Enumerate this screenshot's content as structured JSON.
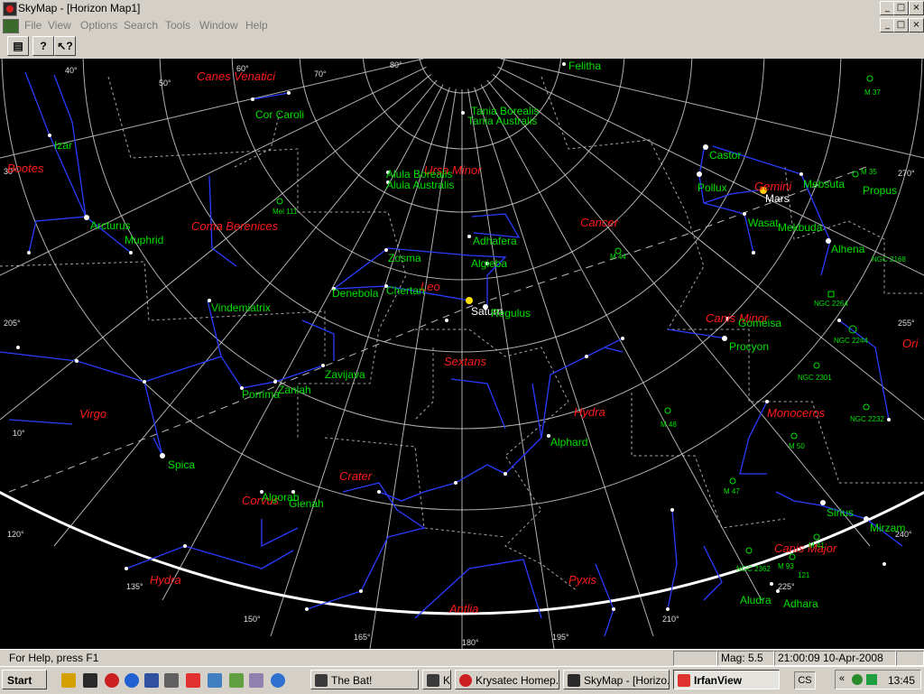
{
  "window": {
    "title": "SkyMap - [Horizon Map1]",
    "controls": [
      "_",
      "□",
      "×"
    ],
    "doc_controls": [
      "_",
      "□",
      "×"
    ]
  },
  "menu": [
    "File",
    "View",
    "Options",
    "Search",
    "Tools",
    "Window",
    "Help"
  ],
  "toolbar": {
    "buttons": [
      {
        "name": "open-folder-icon",
        "glyph": "▤"
      },
      {
        "name": "help-icon",
        "glyph": "?"
      },
      {
        "name": "context-help-icon",
        "glyph": "↖?"
      }
    ]
  },
  "sky": {
    "stars": [
      {
        "label": "Felitha"
      },
      {
        "label": "Cor Caroli"
      },
      {
        "label": "Tania Borealis"
      },
      {
        "label": "Tania Australis"
      },
      {
        "label": "Izar"
      },
      {
        "label": "Alula Borealis"
      },
      {
        "label": "Alula Australis"
      },
      {
        "label": "Castor"
      },
      {
        "label": "Pollux"
      },
      {
        "label": "Mars"
      },
      {
        "label": "Mebsuta"
      },
      {
        "label": "Propus"
      },
      {
        "label": "Arcturus"
      },
      {
        "label": "Muphrid"
      },
      {
        "label": "Wasat"
      },
      {
        "label": "Mekbuda"
      },
      {
        "label": "Adhafera"
      },
      {
        "label": "Algieba"
      },
      {
        "label": "Alhena"
      },
      {
        "label": "Zosma"
      },
      {
        "label": "Denebola"
      },
      {
        "label": "Chertan"
      },
      {
        "label": "Saturn"
      },
      {
        "label": "Regulus"
      },
      {
        "label": "Vindemiatrix"
      },
      {
        "label": "Gomeisa"
      },
      {
        "label": "Procyon"
      },
      {
        "label": "Zavijava"
      },
      {
        "label": "Zaniah"
      },
      {
        "label": "Porrima"
      },
      {
        "label": "Alphard"
      },
      {
        "label": "Spica"
      },
      {
        "label": "Algorab"
      },
      {
        "label": "Gienah"
      },
      {
        "label": "Sirius"
      },
      {
        "label": "Mirzam"
      },
      {
        "label": "Aludra"
      },
      {
        "label": "Adhara"
      }
    ],
    "constellations": [
      "Canes Venatici",
      "Ursa Minor",
      "Bootes",
      "Coma Berenices",
      "Cancer",
      "Gemini",
      "Leo",
      "Canis Minor",
      "Sextans",
      "Hydra",
      "Monoceros",
      "Virgo",
      "Crater",
      "Corvus",
      "Canis Major",
      "Hydra",
      "Pyxis",
      "Antlia",
      "Ori"
    ],
    "deep_sky": [
      "M 37",
      "M 35",
      "NGC 2168",
      "Mel 111",
      "M 44",
      "NGC 2264",
      "NGC 2244",
      "NGC 2301",
      "M 48",
      "NGC 2232",
      "M 50",
      "M 47",
      "M 41",
      "NGC 2362",
      "M 93",
      "121"
    ],
    "degree_labels": [
      "40°",
      "50°",
      "60°",
      "70°",
      "80°",
      "30°",
      "205°",
      "255°",
      "270°",
      "10°",
      "120°",
      "135°",
      "150°",
      "165°",
      "180°",
      "195°",
      "210°",
      "225°",
      "240°"
    ],
    "colors": {
      "lines": "#2a3cff",
      "labels": "#00e000",
      "constellations": "#ff1a1a",
      "grid": "#cfcfcf"
    }
  },
  "status": {
    "help": "For Help, press F1",
    "mag": "Mag: 5.5",
    "datetime": "21:00:09 10-Apr-2008"
  },
  "taskbar": {
    "start": "Start",
    "tasks": [
      {
        "label": "The Bat!"
      },
      {
        "label": "K"
      },
      {
        "label": "Krysatec Homep..."
      },
      {
        "label": "SkyMap - [Horizo..."
      },
      {
        "label": "IrfanView"
      }
    ],
    "lang": "CS",
    "clock": "13:45"
  }
}
